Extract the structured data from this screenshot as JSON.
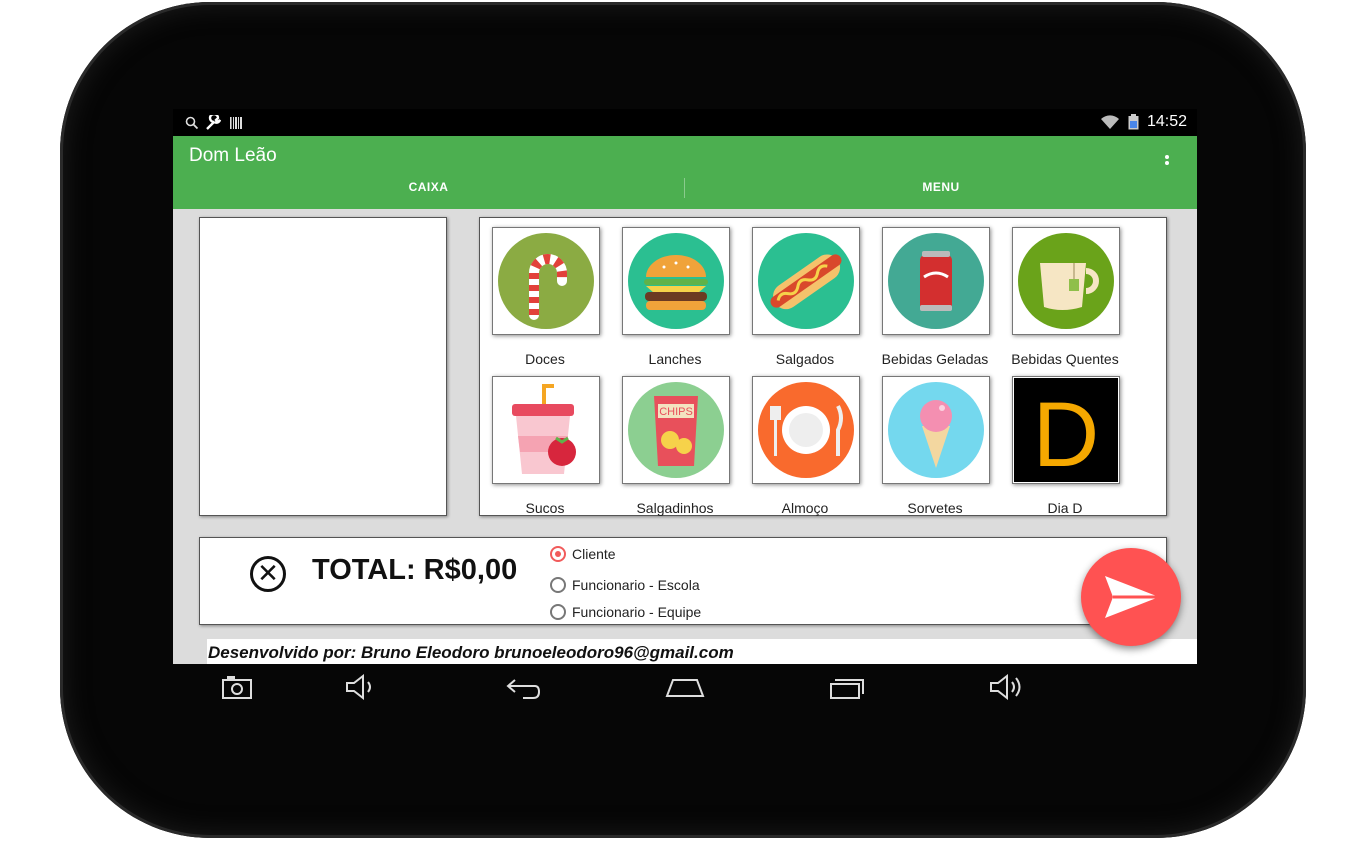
{
  "status_bar": {
    "time": "14:52",
    "left_icons": [
      "search-icon",
      "wrench-icon",
      "barcode-icon"
    ],
    "right_icons": [
      "wifi-icon",
      "battery-icon"
    ]
  },
  "app_bar": {
    "title": "Dom Leão",
    "tabs": [
      {
        "label": "CAIXA"
      },
      {
        "label": "MENU"
      }
    ],
    "overflow_icon": "more-vert-icon"
  },
  "menu": {
    "items": [
      {
        "label": "Doces",
        "icon": "candy-cane-icon",
        "color": "#8bab43"
      },
      {
        "label": "Lanches",
        "icon": "burger-icon",
        "color": "#2bbf91"
      },
      {
        "label": "Salgados",
        "icon": "hotdog-icon",
        "color": "#2bbf91"
      },
      {
        "label": "Bebidas Geladas",
        "icon": "soda-can-icon",
        "color": "#43a994"
      },
      {
        "label": "Bebidas Quentes",
        "icon": "tea-cup-icon",
        "color": "#6aa31a"
      },
      {
        "label": "Sucos",
        "icon": "juice-cup-icon",
        "color": "#ffffff"
      },
      {
        "label": "Salgadinhos",
        "icon": "chips-bag-icon",
        "color": "#8ccf91"
      },
      {
        "label": "Almoço",
        "icon": "plate-cutlery-icon",
        "color": "#f96a2d"
      },
      {
        "label": "Sorvetes",
        "icon": "ice-cream-icon",
        "color": "#74d8ee"
      },
      {
        "label": "Dia D",
        "icon": "letter-d-icon",
        "color": "#000000",
        "glyph": "D",
        "glyph_color": "#f5a800"
      }
    ]
  },
  "total": {
    "label": "TOTAL: R$0,00",
    "clear_glyph": "✕"
  },
  "customer_type": {
    "selected": "Cliente",
    "options": [
      {
        "label": "Cliente",
        "checked": true
      },
      {
        "label": "Funcionario - Escola",
        "checked": false
      },
      {
        "label": "Funcionario - Equipe",
        "checked": false
      }
    ]
  },
  "credits": "Desenvolvido por: Bruno Eleodoro brunoeleodoro96@gmail.com",
  "fab": {
    "icon": "send-icon",
    "color": "#ff5252"
  },
  "nav_bar": {
    "icons": [
      "camera-icon",
      "volume-down-icon",
      "back-icon",
      "home-icon",
      "recents-icon",
      "volume-up-icon"
    ]
  },
  "colors": {
    "accent": "#4caf50",
    "fab": "#ff5252",
    "radio_checked": "#f15b5b"
  }
}
